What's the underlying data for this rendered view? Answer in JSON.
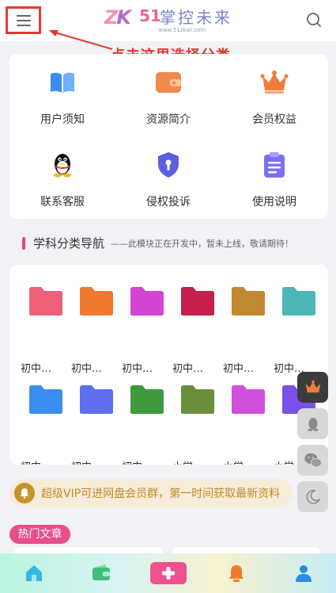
{
  "header": {
    "logo_zk_z": "Z",
    "logo_zk_k": "K",
    "logo_number": "51",
    "logo_title": "掌控未来",
    "logo_url": "www.51zkwl.com",
    "menu_icon": "hamburger-icon",
    "search_icon": "search-icon"
  },
  "annotation": {
    "text": "点击这里选择分类",
    "color": "#e53935"
  },
  "services": [
    {
      "label": "用户须知",
      "icon": "book-icon",
      "color": "#3b8cf0"
    },
    {
      "label": "资源简介",
      "icon": "wallet-icon",
      "color": "#f08a4b"
    },
    {
      "label": "会员权益",
      "icon": "crown-icon",
      "color": "#f47a3a"
    },
    {
      "label": "联系客服",
      "icon": "qq-penguin-icon",
      "color": "#000000"
    },
    {
      "label": "侵权投诉",
      "icon": "shield-icon",
      "color": "#5b5fe0"
    },
    {
      "label": "使用说明",
      "icon": "clipboard-icon",
      "color": "#7b6ef6"
    }
  ],
  "subject_nav": {
    "title": "学科分类导航",
    "subtitle": "——此模块正在开发中，暂未上线，敬请期待！",
    "rows": [
      [
        {
          "label": "初中…",
          "color": "#ef5f78"
        },
        {
          "label": "初中…",
          "color": "#f0792f"
        },
        {
          "label": "初中…",
          "color": "#d344d2"
        },
        {
          "label": "初中…",
          "color": "#c81e4a"
        },
        {
          "label": "初中…",
          "color": "#c08830"
        },
        {
          "label": "初中…",
          "color": "#4cb7b4"
        }
      ],
      [
        {
          "label": "初中…",
          "color": "#3b8ef0"
        },
        {
          "label": "初中…",
          "color": "#5f6ff0"
        },
        {
          "label": "初中…",
          "color": "#3e9a3e"
        },
        {
          "label": "小学…",
          "color": "#6b8e3a"
        },
        {
          "label": "小学…",
          "color": "#d14fdd"
        },
        {
          "label": "小学",
          "color": "#7b4fe8"
        }
      ]
    ]
  },
  "floating_buttons": [
    {
      "icon": "crown-icon",
      "bg": "#3b3b3b"
    },
    {
      "icon": "qq-icon",
      "bg": "#d8d8d8"
    },
    {
      "icon": "wechat-icon",
      "bg": "#d8d8d8"
    },
    {
      "icon": "moon-icon",
      "bg": "#d8d8d8"
    }
  ],
  "notice": {
    "text": "超级VIP可进网盘会员群，第一时间获取最新资料",
    "icon": "bell-icon"
  },
  "hot_articles": {
    "label": "热门文章"
  },
  "bottom_nav": [
    {
      "icon": "home-icon",
      "color": "#36b6e0"
    },
    {
      "icon": "wallet-icon",
      "color": "#3fbf7a"
    },
    {
      "icon": "plus-icon",
      "color": "#f0508f"
    },
    {
      "icon": "bell-icon",
      "color": "#f07c2b"
    },
    {
      "icon": "user-icon",
      "color": "#2b8de8"
    }
  ]
}
